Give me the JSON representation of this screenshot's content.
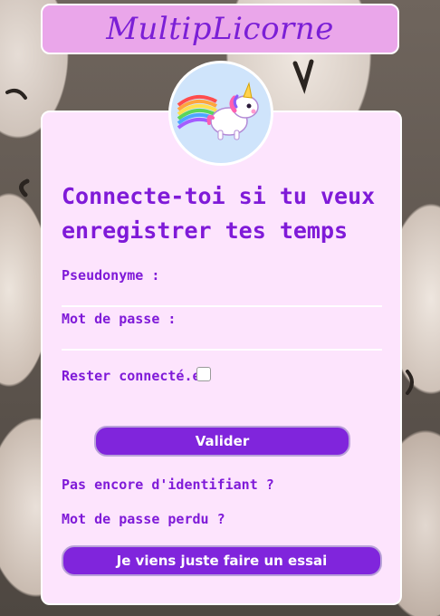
{
  "app": {
    "title": "MultipLicorne"
  },
  "avatar": {
    "icon": "unicorn-icon"
  },
  "login": {
    "heading": "Connecte-toi si tu veux enregistrer tes temps",
    "username_label": "Pseudonyme :",
    "username_value": "",
    "password_label": "Mot de passe :",
    "password_value": "",
    "remember_label": "Rester connecté.e",
    "remember_checked": false,
    "submit_label": "Valider"
  },
  "links": {
    "no_account": "Pas encore d'identifiant ?",
    "forgot_password": "Mot de passe perdu ?"
  },
  "trial_button_label": "Je viens juste faire un essai",
  "colors": {
    "accent": "#8025dc",
    "text": "#7f1ad8",
    "header_bg": "#eaa6ea",
    "card_bg": "#fde4fd",
    "avatar_bg": "#cfe4fb"
  }
}
